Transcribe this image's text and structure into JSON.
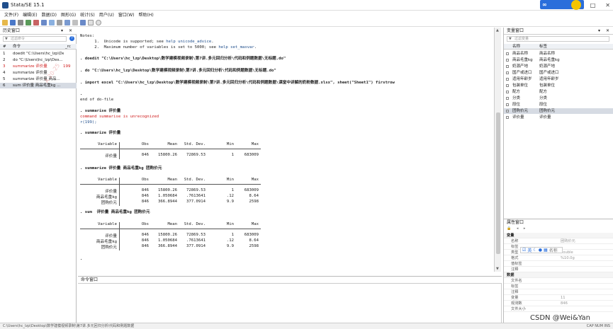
{
  "window": {
    "title": "Stata/SE 15.1"
  },
  "menu": [
    "文件(F)",
    "编辑(E)",
    "数据(D)",
    "图形(G)",
    "统计(S)",
    "用户(U)",
    "窗口(W)",
    "帮助(H)"
  ],
  "history": {
    "title": "历史窗口",
    "filter_placeholder": "过滤命令",
    "col_num": "#",
    "col_cmd": "命令",
    "col_rc": "_rc",
    "rows": [
      {
        "n": "1",
        "cmd": "doedit \"C:\\Users\\hc_lzp\\Desk...",
        "rc": ""
      },
      {
        "n": "2",
        "cmd": "do \"C:\\Users\\hc_lzp\\Des...",
        "rc": ""
      },
      {
        "n": "3",
        "cmd": "summarize 评价量",
        "rc": "199"
      },
      {
        "n": "4",
        "cmd": "summarize 评价量",
        "rc": ""
      },
      {
        "n": "5",
        "cmd": "summarize 评价量 商品...",
        "rc": ""
      },
      {
        "n": "6",
        "cmd": "sum 评价量 商品毛重kg ...",
        "rc": ""
      }
    ],
    "watermark": "A 20-25"
  },
  "results": {
    "notes_header": "Notes:",
    "note1_pre": "      1.  Unicode is supported; see ",
    "note1_link": "help unicode_advice",
    "note1_post": ".",
    "note2_pre": "      2.  Maximum number of variables is set to 5000; see ",
    "note2_link": "help set_maxvar",
    "note2_post": ".",
    "cmd_doedit": ". doedit \"C:\\Users\\hc_lzp\\Desktop\\数学建模视频录制\\第7讲.多元回归分析\\代码和例题数据\\无标题.do\"",
    "cmd_do": ". do \"C:\\Users\\hc_lzp\\Desktop\\数学建模视频录制\\第7讲.多元回归分析\\代码和例题数据\\无标题.do\"",
    "cmd_import": ". import excel \"C:\\Users\\hc_lzp\\Desktop\\数学建模视频录制\\第7讲.多元回归分析\\代码和例题数据\\课堂中讲解的奶粉数据.xlsx\", sheet(\"Sheet1\") firstrow",
    "dot": ".",
    "end_do": "end of do-file",
    "cmd_sum1": ". summarise 评价量",
    "err1": "command summarise is unrecognized",
    "err2": "r(199);",
    "cmd_sum2": ". summarize 评价量",
    "cmd_sum3": ". summarize 评价量 商品毛重kg 团购价元",
    "cmd_sum4": ". sum  评价量 商品毛重kg 团购价元",
    "final_dot": "."
  },
  "stats_header": {
    "variable": "Variable",
    "obs": "Obs",
    "mean": "Mean",
    "sd": "Std. Dev.",
    "min": "Min",
    "max": "Max"
  },
  "tables": [
    {
      "rows": [
        {
          "v": "评价量",
          "obs": "846",
          "mean": "15800.26",
          "sd": "72869.53",
          "min": "1",
          "max": "683009"
        }
      ]
    },
    {
      "rows": [
        {
          "v": "评价量",
          "obs": "846",
          "mean": "15800.26",
          "sd": "72869.53",
          "min": "1",
          "max": "683009"
        },
        {
          "v": "商品毛重kg",
          "obs": "846",
          "mean": "1.050684",
          "sd": ".7613641",
          "min": ".12",
          "max": "8.64"
        },
        {
          "v": "团购价元",
          "obs": "846",
          "mean": "366.8944",
          "sd": "377.0914",
          "min": "9.9",
          "max": "2598"
        }
      ]
    },
    {
      "rows": [
        {
          "v": "评价量",
          "obs": "846",
          "mean": "15800.26",
          "sd": "72869.53",
          "min": "1",
          "max": "683009"
        },
        {
          "v": "商品毛重kg",
          "obs": "846",
          "mean": "1.050684",
          "sd": ".7613641",
          "min": ".12",
          "max": "8.64"
        },
        {
          "v": "团购价元",
          "obs": "846",
          "mean": "366.8944",
          "sd": "377.0914",
          "min": "9.9",
          "max": "2598"
        }
      ]
    }
  ],
  "command_window": {
    "title": "命令窗口"
  },
  "variables": {
    "title": "变量窗口",
    "filter_placeholder": "过滤变量",
    "col_name": "名称",
    "col_label": "标签",
    "rows": [
      {
        "name": "商品名称",
        "label": "商品名称"
      },
      {
        "name": "商品毛重kg",
        "label": "商品毛重kg"
      },
      {
        "name": "奶源产地",
        "label": "奶源产地"
      },
      {
        "name": "国产或进口",
        "label": "国产或进口"
      },
      {
        "name": "适用年龄岁",
        "label": "适用年龄岁"
      },
      {
        "name": "包装单位",
        "label": "包装单位"
      },
      {
        "name": "配方",
        "label": "配方"
      },
      {
        "name": "分类",
        "label": "分类"
      },
      {
        "name": "段位",
        "label": "段位"
      },
      {
        "name": "团购价元",
        "label": "团购价元"
      },
      {
        "name": "评价量",
        "label": "评价量"
      }
    ]
  },
  "properties": {
    "title": "属性窗口",
    "mini_text": "名称",
    "rows": [
      {
        "k": "变量",
        "v": "",
        "sec": true
      },
      {
        "k": "名称",
        "v": "团购价元",
        "sec": false
      },
      {
        "k": "标签",
        "v": "",
        "sec": false
      },
      {
        "k": "类型",
        "v": "double",
        "sec": false
      },
      {
        "k": "格式",
        "v": "%10.0g",
        "sec": false
      },
      {
        "k": "值标签",
        "v": "",
        "sec": false
      },
      {
        "k": "注释",
        "v": "",
        "sec": false
      },
      {
        "k": "数据",
        "v": "",
        "sec": true
      },
      {
        "k": "文件名",
        "v": "",
        "sec": false
      },
      {
        "k": "标签",
        "v": "",
        "sec": false
      },
      {
        "k": "注释",
        "v": "",
        "sec": false
      },
      {
        "k": "变量",
        "v": "11",
        "sec": false
      },
      {
        "k": "观测数",
        "v": "846",
        "sec": false
      },
      {
        "k": "文件大小",
        "v": "",
        "sec": false
      }
    ]
  },
  "statusbar": {
    "path": "C:\\Users\\hc_lzp\\Desktop\\数学建模视频录制\\第7讲.多元回归分析\\代码和例题数据",
    "right": "CAP  NUM  INS"
  },
  "watermark_csdn": "CSDN @Wei&Yan",
  "colors": {
    "accent": "#2a6edb",
    "error": "#d02020",
    "link": "#1f4e8c"
  }
}
